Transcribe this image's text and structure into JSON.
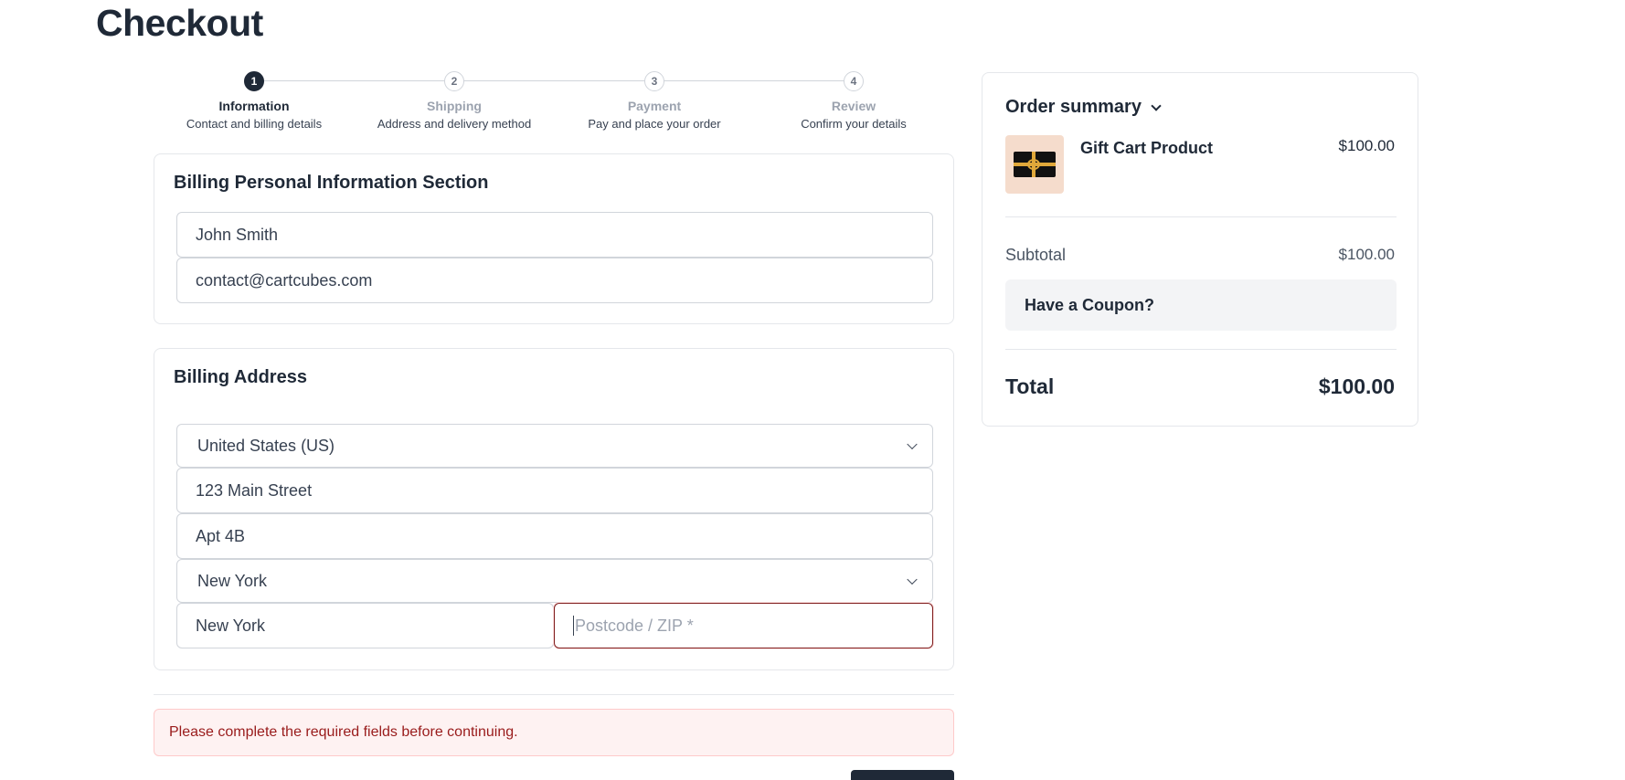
{
  "page": {
    "title": "Checkout"
  },
  "stepper": {
    "steps": [
      {
        "number": "1",
        "title": "Information",
        "subtitle": "Contact and billing details",
        "active": true
      },
      {
        "number": "2",
        "title": "Shipping",
        "subtitle": "Address and delivery method",
        "active": false
      },
      {
        "number": "3",
        "title": "Payment",
        "subtitle": "Pay and place your order",
        "active": false
      },
      {
        "number": "4",
        "title": "Review",
        "subtitle": "Confirm your details",
        "active": false
      }
    ]
  },
  "personal": {
    "title": "Billing Personal Information Section",
    "name": "John Smith",
    "email": "contact@cartcubes.com"
  },
  "address": {
    "title": "Billing Address",
    "country": "United States (US)",
    "street": "123 Main Street",
    "apartment": "Apt 4B",
    "state": "New York",
    "city": "New York",
    "postcode_placeholder": "Postcode / ZIP *"
  },
  "alert": {
    "message": "Please complete the required fields before continuing."
  },
  "summary": {
    "title": "Order summary",
    "product": {
      "name": "Gift Cart Product",
      "price": "$100.00"
    },
    "subtotal_label": "Subtotal",
    "subtotal_value": "$100.00",
    "coupon_label": "Have a Coupon?",
    "total_label": "Total",
    "total_value": "$100.00"
  },
  "colors": {
    "primary": "#1f2937",
    "alert_bg": "#fef2f2",
    "alert_text": "#991b1b",
    "thumb_bg": "#f5dccc"
  }
}
